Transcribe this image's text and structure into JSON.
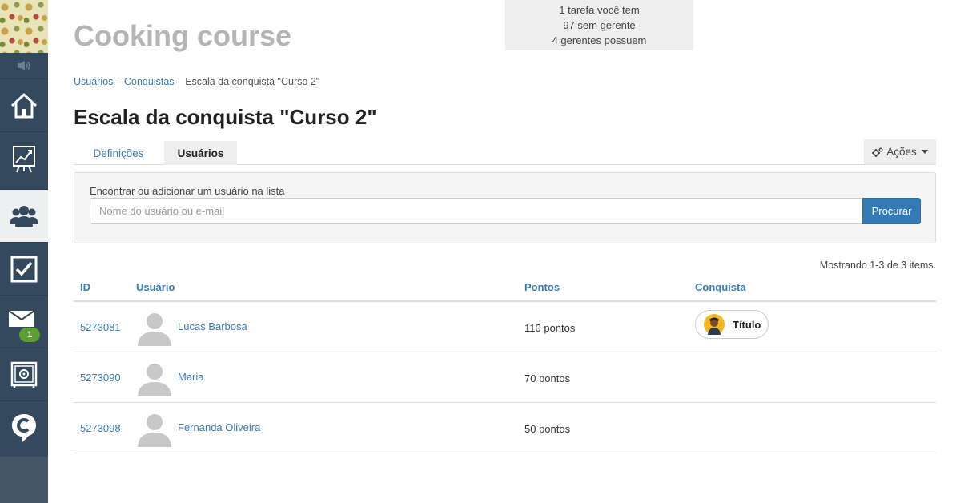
{
  "app": {
    "brand": "Cooking course"
  },
  "stats": {
    "line1": "1 tarefa você tem",
    "line2": "97 sem gerente",
    "line3": "4 gerentes possuem"
  },
  "sidebar": {
    "items": [
      {
        "icon": "home-icon",
        "active": false
      },
      {
        "icon": "chart-icon",
        "active": false
      },
      {
        "icon": "users-icon",
        "active": true
      },
      {
        "icon": "checkbox-icon",
        "active": false
      },
      {
        "icon": "mail-icon",
        "active": false,
        "badge": "1"
      },
      {
        "icon": "safe-icon",
        "active": false
      },
      {
        "icon": "chat-logo-icon",
        "active": false
      }
    ]
  },
  "breadcrumb": {
    "items": [
      "Usuários",
      "Conquistas",
      "Escala da conquista \"Curso 2\""
    ],
    "separator": "-"
  },
  "page": {
    "title": "Escala da conquista \"Curso 2\""
  },
  "tabs": [
    {
      "label": "Definições",
      "active": false
    },
    {
      "label": "Usuários",
      "active": true
    }
  ],
  "actions": {
    "label": "Ações"
  },
  "search": {
    "label": "Encontrar ou adicionar um usuário na lista",
    "placeholder": "Nome do usuário ou e-mail",
    "value": "",
    "button": "Procurar"
  },
  "summary": "Mostrando 1-3 de 3 items.",
  "table": {
    "headers": [
      "ID",
      "Usuário",
      "Pontos",
      "Conquista"
    ],
    "rows": [
      {
        "id": "5273081",
        "name": "Lucas Barbosa",
        "points": "110 pontos",
        "achievement": "Título"
      },
      {
        "id": "5273090",
        "name": "Maria",
        "points": "70 pontos",
        "achievement": ""
      },
      {
        "id": "5273098",
        "name": "Fernanda Oliveira",
        "points": "50 pontos",
        "achievement": ""
      }
    ]
  },
  "colors": {
    "sidebar": "#34495e",
    "link": "#3a7cb8",
    "primary_button": "#337ab7",
    "badge": "#5aa132"
  }
}
